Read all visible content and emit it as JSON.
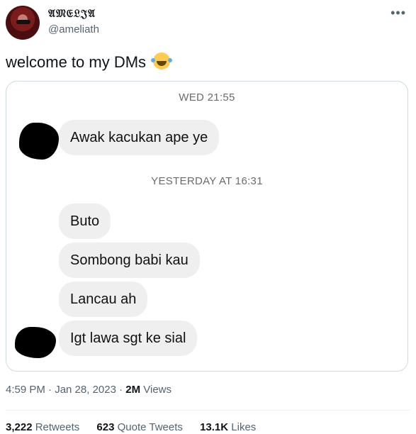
{
  "author": {
    "display_name": "𝔄𝔐𝔈𝔏𝔍𝔄",
    "handle": "@ameliath"
  },
  "more_icon": "•••",
  "tweet": {
    "text": "welcome to my DMs",
    "emoji": "face-with-tears-of-joy"
  },
  "dm_screenshot": {
    "timestamp_1": "WED 21:55",
    "message_1": "Awak kacukan ape ye",
    "timestamp_2": "YESTERDAY AT 16:31",
    "messages": [
      "Buto",
      "Sombong babi kau",
      "Lancau ah",
      "Igt lawa sgt ke sial"
    ]
  },
  "meta": {
    "time": "4:59 PM · Jan 28, 2023 · ",
    "views_count": "2M",
    "views_label": " Views"
  },
  "stats": {
    "retweets_count": "3,222",
    "retweets_label": " Retweets",
    "quotes_count": "623",
    "quotes_label": " Quote Tweets",
    "likes_count": "13.1K",
    "likes_label": " Likes"
  },
  "colors": {
    "text": "#0f1419",
    "secondary": "#536471",
    "bubble": "#efefef",
    "border": "#cfd9de"
  }
}
